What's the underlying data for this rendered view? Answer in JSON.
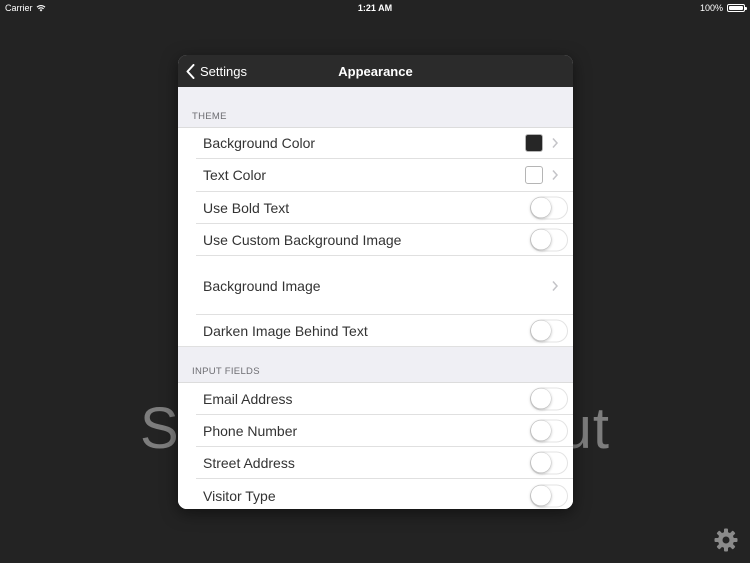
{
  "status_bar": {
    "carrier": "Carrier",
    "time": "1:21 AM",
    "battery": "100%",
    "battery_level": 1.0
  },
  "background_text": {
    "left": "S",
    "right": "ut"
  },
  "nav": {
    "back_label": "Settings",
    "title": "Appearance"
  },
  "sections": {
    "theme": {
      "header": "THEME",
      "rows": {
        "background_color": {
          "label": "Background Color",
          "swatch": "#262626"
        },
        "text_color": {
          "label": "Text Color",
          "swatch": "#ffffff"
        },
        "use_bold_text": {
          "label": "Use Bold Text",
          "on": false
        },
        "use_custom_bg_image": {
          "label": "Use Custom Background Image",
          "on": false
        },
        "background_image": {
          "label": "Background Image"
        },
        "darken_image": {
          "label": "Darken Image Behind Text",
          "on": false
        }
      }
    },
    "input_fields": {
      "header": "INPUT FIELDS",
      "rows": {
        "email_address": {
          "label": "Email Address",
          "on": false
        },
        "phone_number": {
          "label": "Phone Number",
          "on": false
        },
        "street_address": {
          "label": "Street Address",
          "on": false
        },
        "visitor_type": {
          "label": "Visitor Type",
          "on": false
        }
      }
    }
  },
  "icons": {
    "back": "chevron-left-icon",
    "disclosure": "chevron-right-icon",
    "settings": "gear-icon",
    "wifi": "wifi-icon",
    "battery": "battery-icon"
  },
  "colors": {
    "page_background": "#232323",
    "nav_background": "#2b2b2b",
    "group_background": "#efeff4",
    "row_text": "#333333",
    "section_header_text": "#6d6d72"
  }
}
